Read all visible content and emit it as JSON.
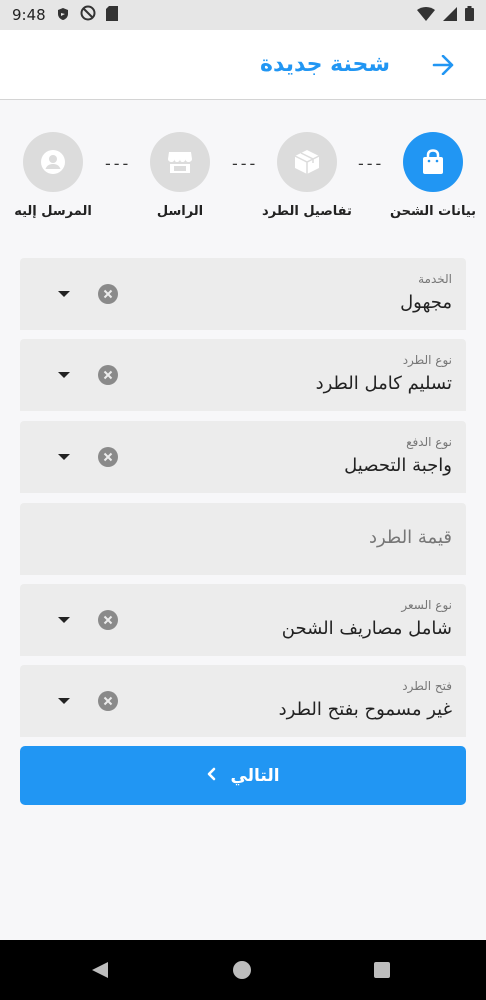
{
  "status_bar": {
    "time": "9:48"
  },
  "app_bar": {
    "title": "شحنة جديدة"
  },
  "stepper": {
    "steps": [
      {
        "label": "بيانات الشحن"
      },
      {
        "label": "تفاصيل الطرد"
      },
      {
        "label": "الراسل"
      },
      {
        "label": "المرسل إليه"
      }
    ],
    "separator": "---"
  },
  "form": {
    "service": {
      "label": "الخدمة",
      "value": "مجهول"
    },
    "parcel_type": {
      "label": "نوع الطرد",
      "value": "تسليم كامل الطرد"
    },
    "payment_type": {
      "label": "نوع الدفع",
      "value": "واجبة التحصيل"
    },
    "parcel_value": {
      "placeholder": "قيمة الطرد"
    },
    "price_type": {
      "label": "نوع السعر",
      "value": "شامل مصاريف الشحن"
    },
    "open_parcel": {
      "label": "فتح الطرد",
      "value": "غير مسموح بفتح الطرد"
    }
  },
  "next_button": {
    "label": "التالي"
  },
  "colors": {
    "accent": "#2196f3",
    "field_bg": "#ececec",
    "inactive_step": "#dcdcdc"
  }
}
